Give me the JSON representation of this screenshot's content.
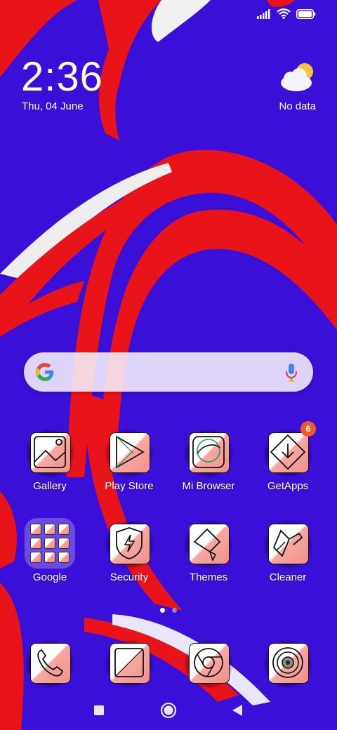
{
  "status_bar": {
    "icons": [
      "signal-icon",
      "wifi-icon",
      "battery-icon"
    ]
  },
  "lock": {
    "time": "2:36",
    "date": "Thu, 04 June"
  },
  "weather": {
    "icon": "partly-cloudy-icon",
    "text": "No data"
  },
  "search": {
    "left_icon": "google-g-icon",
    "right_icon": "mic-icon"
  },
  "apps_row1": [
    {
      "label": "Gallery",
      "icon": "gallery-icon"
    },
    {
      "label": "Play Store",
      "icon": "play-store-icon"
    },
    {
      "label": "Mi Browser",
      "icon": "browser-icon"
    },
    {
      "label": "GetApps",
      "icon": "getapps-icon",
      "badge": "6"
    }
  ],
  "apps_row2": [
    {
      "label": "Google",
      "icon": "folder-icon"
    },
    {
      "label": "Security",
      "icon": "security-icon"
    },
    {
      "label": "Themes",
      "icon": "themes-icon"
    },
    {
      "label": "Cleaner",
      "icon": "cleaner-icon"
    }
  ],
  "dock": [
    {
      "icon": "phone-icon"
    },
    {
      "icon": "messages-icon"
    },
    {
      "icon": "chrome-icon"
    },
    {
      "icon": "camera-icon"
    }
  ],
  "page_indicator": {
    "pages": 2,
    "current": 1
  },
  "nav": [
    "recents-button",
    "home-button",
    "back-button"
  ],
  "colors": {
    "wallpaper_blue": "#3a0fd8",
    "wallpaper_red": "#e8141a",
    "badge": "#f05a22",
    "icon_pink": "#f29088"
  }
}
